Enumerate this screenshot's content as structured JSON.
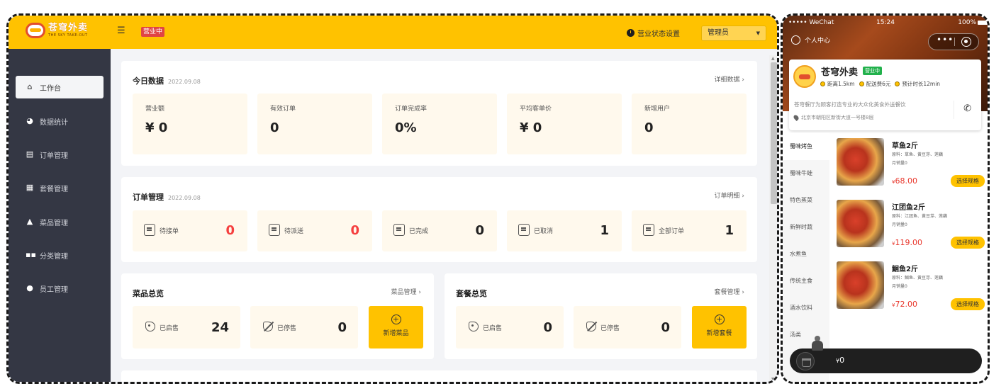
{
  "admin": {
    "logo": {
      "cn": "苍穹外卖",
      "en": "THE SKY TAKE-OUT"
    },
    "menu_toggle_icon": "menu-fold-icon",
    "status_tag": "营业中",
    "status_setting": "营业状态设置",
    "role": "管理员",
    "nav": [
      {
        "label": "工作台",
        "icon": "home-icon",
        "active": true
      },
      {
        "label": "数据统计",
        "icon": "chart-icon"
      },
      {
        "label": "订单管理",
        "icon": "order-icon"
      },
      {
        "label": "套餐管理",
        "icon": "combo-icon"
      },
      {
        "label": "菜品管理",
        "icon": "dish-icon"
      },
      {
        "label": "分类管理",
        "icon": "category-icon"
      },
      {
        "label": "员工管理",
        "icon": "staff-icon"
      }
    ],
    "today": {
      "title": "今日数据",
      "date": "2022.09.08",
      "link": "详细数据",
      "stats": [
        {
          "label": "营业额",
          "value": "¥ 0"
        },
        {
          "label": "有效订单",
          "value": "0"
        },
        {
          "label": "订单完成率",
          "value": "0%"
        },
        {
          "label": "平均客单价",
          "value": "¥ 0"
        },
        {
          "label": "新增用户",
          "value": "0"
        }
      ]
    },
    "orders": {
      "title": "订单管理",
      "date": "2022.09.08",
      "link": "订单明细",
      "items": [
        {
          "label": "待接单",
          "value": "0",
          "highlight": true
        },
        {
          "label": "待派送",
          "value": "0",
          "highlight": true
        },
        {
          "label": "已完成",
          "value": "0"
        },
        {
          "label": "已取消",
          "value": "1"
        },
        {
          "label": "全部订单",
          "value": "1"
        }
      ]
    },
    "dishes": {
      "title": "菜品总览",
      "link": "菜品管理",
      "on_label": "已启售",
      "on_value": "24",
      "off_label": "已停售",
      "off_value": "0",
      "add_label": "新增菜品"
    },
    "combos": {
      "title": "套餐总览",
      "link": "套餐管理",
      "on_label": "已启售",
      "on_value": "0",
      "off_label": "已停售",
      "off_value": "0",
      "add_label": "新增套餐"
    }
  },
  "phone": {
    "status": {
      "carrier": "••••• WeChat",
      "time": "15:24",
      "battery": "100%"
    },
    "personal": "个人中心",
    "shop": {
      "name": "苍穹外卖",
      "open": "营业中",
      "distance": "距离1.5km",
      "delivery_fee": "配送费6元",
      "eta": "预计时长12min",
      "desc": "苍穹餐厅为顾客打造专业的大众化美食外送餐饮",
      "address": "北京市朝阳区新街大道一号楼8层"
    },
    "categories": [
      "蜀味烤鱼",
      "蜀味牛蛙",
      "特色蒸菜",
      "新鲜时蔬",
      "水煮鱼",
      "传统主食",
      "酒水饮料",
      "汤类"
    ],
    "dishes": [
      {
        "name": "草鱼2斤",
        "desc": "原料：草鱼、黄豆芽、莲藕",
        "sales": "月销量0",
        "price": "68.00",
        "btn": "选择规格"
      },
      {
        "name": "江团鱼2斤",
        "desc": "原料：江团鱼、黄豆芽、莲藕",
        "sales": "月销量0",
        "price": "119.00",
        "btn": "选择规格"
      },
      {
        "name": "鮰鱼2斤",
        "desc": "原料：鮰鱼、黄豆芽、莲藕",
        "sales": "月销量0",
        "price": "72.00",
        "btn": "选择规格"
      }
    ],
    "currency": "¥",
    "cart_total": "0"
  },
  "colors": {
    "brand": "#ffc200",
    "sidebar": "#343744",
    "alert": "#f53f3f",
    "open_green": "#22b14c"
  }
}
